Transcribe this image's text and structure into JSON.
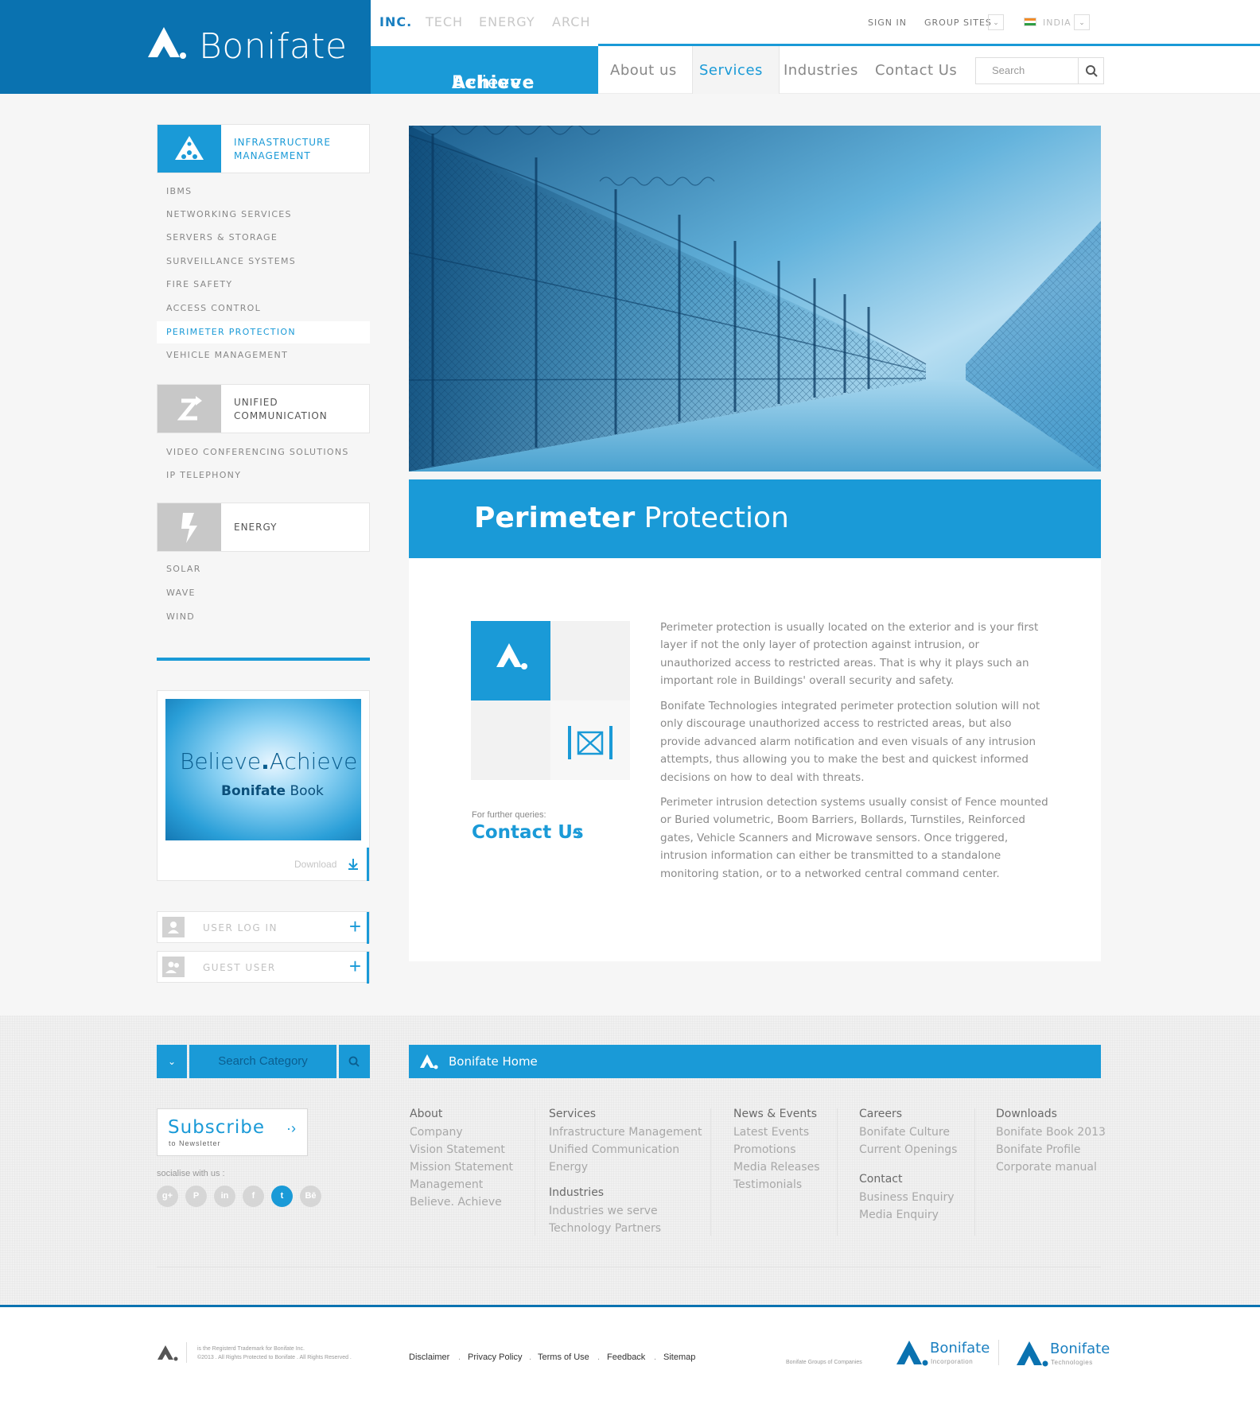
{
  "header": {
    "brand_name": "Bonifate",
    "tagline_a": "Believe",
    "tagline_dot": ".",
    "tagline_b": "Achieve",
    "brand_tabs": [
      "INC.",
      "TECH",
      "ENERGY",
      "ARCH"
    ],
    "sign_in": "SIGN IN",
    "group_sites": "GROUP SITES",
    "country": "INDIA",
    "nav": [
      "About us",
      "Services",
      "Industries",
      "Contact Us"
    ],
    "active_nav": "Services",
    "search_placeholder": "Search",
    "colors": {
      "brand_dark": "#0a72b0",
      "accent": "#1a9ad7"
    }
  },
  "sidebar": {
    "categories": [
      {
        "label_line1": "INFRASTRUCTURE",
        "label_line2": "MANAGEMENT",
        "icon": "triangle-dots-icon",
        "items": [
          "IBMS",
          "NETWORKING SERVICES",
          "SERVERS & STORAGE",
          "SURVEILLANCE SYSTEMS",
          "FIRE SAFETY",
          "ACCESS CONTROL",
          "PERIMETER PROTECTION",
          "VEHICLE MANAGEMENT"
        ]
      },
      {
        "label_line1": "UNIFIED",
        "label_line2": "COMMUNICATION",
        "icon": "communication-arrows-icon",
        "items": [
          "VIDEO CONFERENCING SOLUTIONS",
          "IP TELEPHONY"
        ]
      },
      {
        "label_line1": "ENERGY",
        "label_line2": "",
        "icon": "lightning-icon",
        "items": [
          "SOLAR",
          "WAVE",
          "WIND"
        ]
      }
    ],
    "active_item": "PERIMETER PROTECTION",
    "book": {
      "line1_a": "Believe",
      "line1_dot": ".",
      "line1_b": "Achieve",
      "line2_a": "Bonifate",
      "line2_b": "Book",
      "download": "Download"
    },
    "user_login": "USER LOG IN",
    "guest_user": "GUEST USER"
  },
  "main": {
    "title_bold": "Perimeter",
    "title_light": "Protection",
    "further_queries": "For further queries:",
    "contact_us": "Contact Us",
    "paragraphs": [
      "Perimeter protection is usually located on the exterior and is your first layer if not the only layer of protection against intrusion, or unauthorized access to restricted areas. That is why it plays such an important role in Buildings' overall security and safety.",
      "Bonifate Technologies integrated perimeter protection solution will not only discourage unauthorized access to restricted areas, but also provide advanced alarm notification and even visuals of any intrusion attempts, thus allowing you to make the best and quickest informed decisions on how to deal with threats.",
      "Perimeter intrusion detection systems usually consist of Fence mounted or Buried volumetric, Boom Barriers, Bollards, Turnstiles, Reinforced gates, Vehicle Scanners and Microwave sensors. Once triggered, intrusion information can either be transmitted to a standalone monitoring station, or to a networked central command center."
    ]
  },
  "footer": {
    "search_category": "Search Category",
    "bonifate_home": "Bonifate Home",
    "subscribe": "Subscribe",
    "subscribe_sub": "to Newsletter",
    "socialise": "socialise with us :",
    "social": [
      {
        "glyph": "g+",
        "icon": "google-plus-icon"
      },
      {
        "glyph": "P",
        "icon": "pinterest-icon"
      },
      {
        "glyph": "in",
        "icon": "linkedin-icon"
      },
      {
        "glyph": "f",
        "icon": "facebook-icon"
      },
      {
        "glyph": "t",
        "icon": "twitter-icon",
        "active": true
      },
      {
        "glyph": "Bē",
        "icon": "behance-icon"
      }
    ],
    "columns": {
      "about": {
        "heading": "About",
        "links": [
          "Company",
          "Vision Statement",
          "Mission Statement",
          "Management",
          "Believe. Achieve"
        ]
      },
      "services": {
        "heading": "Services",
        "links": [
          "Infrastructure Management",
          "Unified Communication",
          "Energy"
        ]
      },
      "industries": {
        "heading": "Industries",
        "links": [
          "Industries we serve",
          "Technology Partners"
        ]
      },
      "news": {
        "heading": "News & Events",
        "links": [
          "Latest Events",
          "Promotions",
          "Media Releases",
          "Testimonials"
        ]
      },
      "careers": {
        "heading": "Careers",
        "links": [
          "Bonifate Culture",
          "Current Openings"
        ]
      },
      "contact": {
        "heading": "Contact",
        "links": [
          "Business Enquiry",
          "Media Enquiry"
        ]
      },
      "downloads": {
        "heading": "Downloads",
        "links": [
          "Bonifate Book 2013",
          "Bonifate Profile",
          "Corporate manual"
        ]
      }
    },
    "trademark_1": "is the Registerd Trademark for Bonifate Inc.",
    "trademark_2": "©2013 . All Rights Protected to Bonifate . All Rights Reserved .",
    "legal_links": [
      "Disclaimer",
      "Privacy Policy",
      "Terms of Use",
      "Feedback",
      "Sitemap"
    ],
    "legal_sep": ".",
    "groups_label": "Bonifate Groups of Companies",
    "group1_name": "Bonifate",
    "group1_sub": "Incorporation",
    "group2_name": "Bonifate",
    "group2_sub": "Technologies"
  }
}
